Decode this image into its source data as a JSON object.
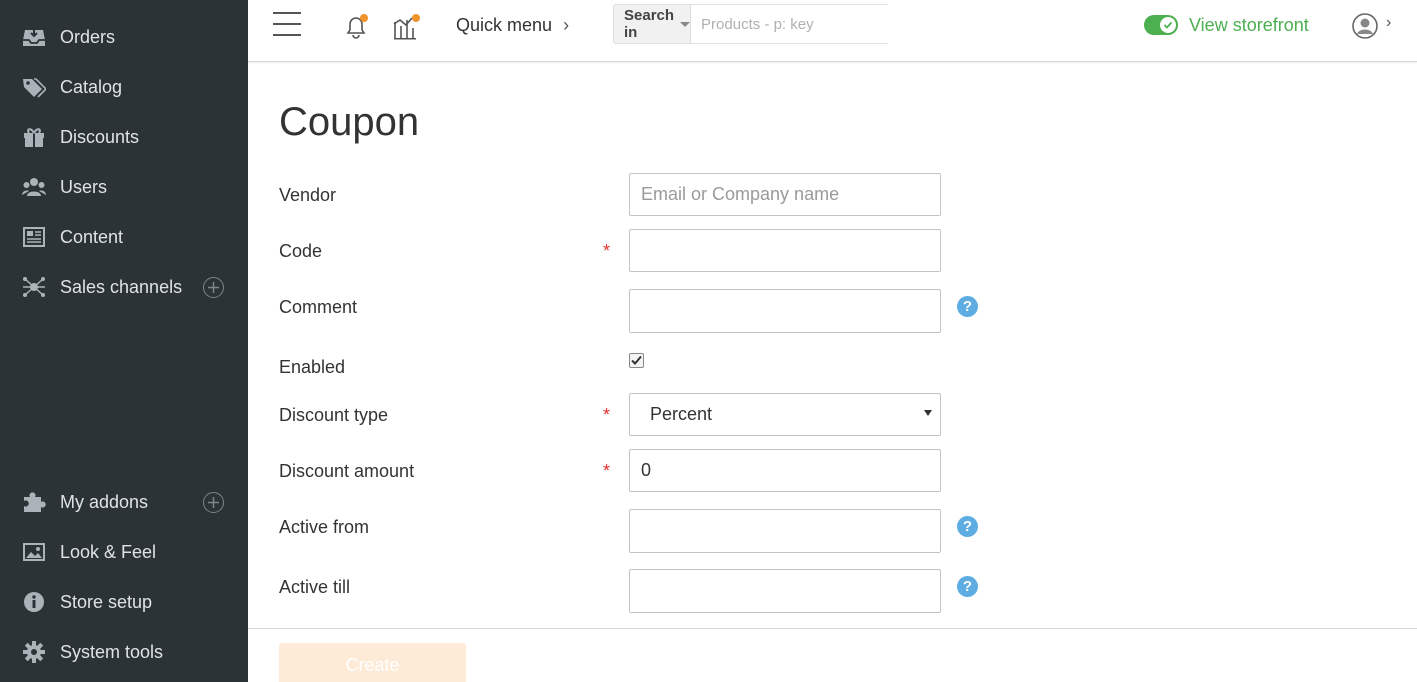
{
  "sidebar": {
    "items": [
      {
        "label": "Orders",
        "icon": "orders-tray-icon"
      },
      {
        "label": "Catalog",
        "icon": "tags-icon"
      },
      {
        "label": "Discounts",
        "icon": "gift-icon"
      },
      {
        "label": "Users",
        "icon": "users-icon"
      },
      {
        "label": "Content",
        "icon": "newspaper-icon"
      },
      {
        "label": "Sales channels",
        "icon": "network-icon"
      },
      {
        "label": "My addons",
        "icon": "puzzle-icon"
      },
      {
        "label": "Look & Feel",
        "icon": "image-icon"
      },
      {
        "label": "Store setup",
        "icon": "info-icon"
      },
      {
        "label": "System tools",
        "icon": "gear-icon"
      }
    ]
  },
  "topbar": {
    "quick_menu": "Quick menu",
    "search_in": "Search in",
    "search_placeholder": "Products - p: key",
    "view_storefront": "View storefront",
    "notification_dot_color": "#f0932b",
    "storefront_color": "#4caf50"
  },
  "page": {
    "title": "Coupon"
  },
  "form": {
    "vendor": {
      "label": "Vendor",
      "placeholder": "Email or Company name",
      "value": ""
    },
    "code": {
      "label": "Code",
      "required": "*",
      "value": ""
    },
    "comment": {
      "label": "Comment",
      "value": ""
    },
    "enabled": {
      "label": "Enabled",
      "checked": true
    },
    "discount_type": {
      "label": "Discount type",
      "required": "*",
      "value": "Percent"
    },
    "discount_amount": {
      "label": "Discount amount",
      "required": "*",
      "value": "0"
    },
    "active_from": {
      "label": "Active from",
      "value": ""
    },
    "active_till": {
      "label": "Active till",
      "value": ""
    },
    "help_glyph": "?"
  },
  "footer": {
    "create_label": "Create"
  }
}
